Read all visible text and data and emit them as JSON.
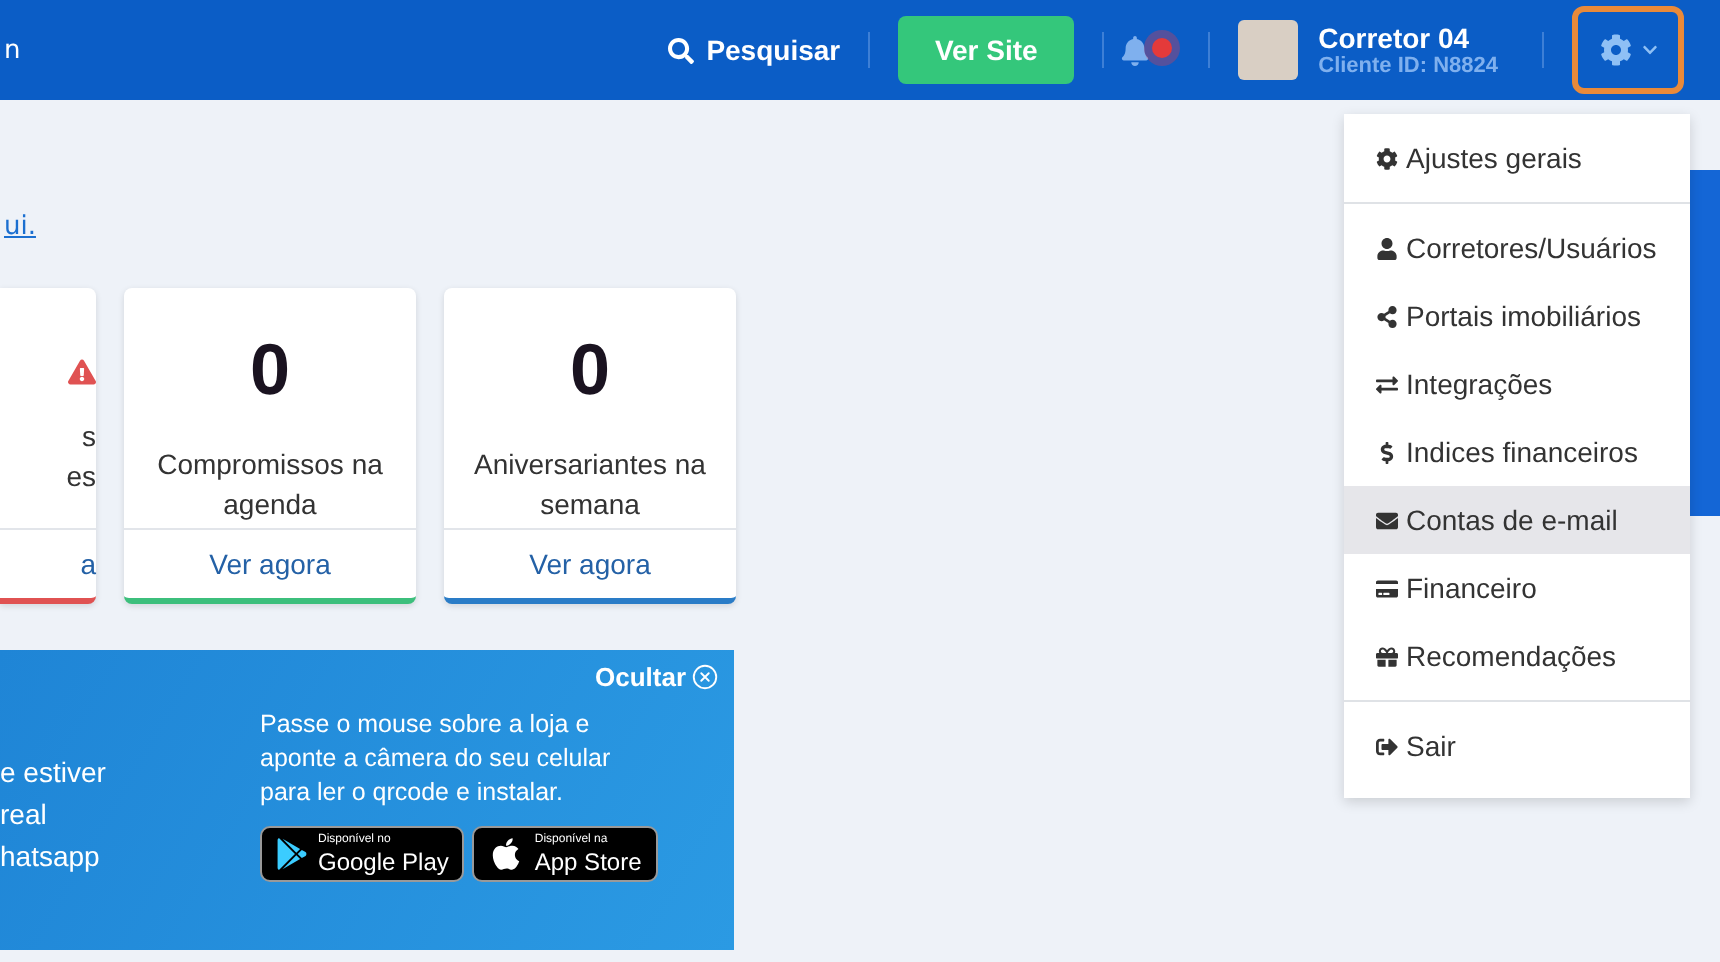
{
  "header": {
    "edge_text": "n",
    "search": "Pesquisar",
    "site_button": "Ver Site",
    "notifications": {
      "unread": true
    },
    "user": {
      "name": "Corretor 04",
      "client_id": "Cliente ID: N8824"
    },
    "settings": {
      "expanded": true
    }
  },
  "link_text": "ui.",
  "cards": [
    {
      "lines": [
        "s",
        "es"
      ],
      "action": "a",
      "color": "#e05252",
      "alert": true
    },
    {
      "number": "0",
      "lines": [
        "Compromissos na",
        "agenda"
      ],
      "action": "Ver agora",
      "color": "#3cbf7c",
      "alert": false
    },
    {
      "number": "0",
      "lines": [
        "Aniversariantes na",
        "semana"
      ],
      "action": "Ver agora",
      "color": "#2a7cc7",
      "alert": false
    }
  ],
  "banner": {
    "left_lines": [
      "e estiver",
      "real",
      "hatsapp"
    ],
    "hide": "Ocultar",
    "text": "Passe o mouse sobre a loja e aponte a câmera do seu celular para ler o qrcode e instalar.",
    "stores": [
      {
        "small": "Disponível no",
        "big": "Google Play"
      },
      {
        "small": "Disponível na",
        "big": "App Store"
      }
    ]
  },
  "menu": {
    "groups": [
      [
        {
          "label": "Ajustes gerais",
          "selected": false
        }
      ],
      [
        {
          "label": "Corretores/Usuários",
          "selected": false
        },
        {
          "label": "Portais imobiliários",
          "selected": false
        },
        {
          "label": "Integrações",
          "selected": false
        },
        {
          "label": "Indices financeiros",
          "selected": false
        },
        {
          "label": "Contas de e-mail",
          "selected": true
        },
        {
          "label": "Financeiro",
          "selected": false
        },
        {
          "label": "Recomendações",
          "selected": false
        }
      ],
      [
        {
          "label": "Sair",
          "selected": false
        }
      ]
    ]
  }
}
